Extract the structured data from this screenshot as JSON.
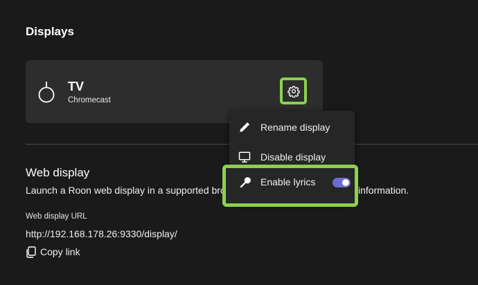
{
  "section": {
    "title": "Displays"
  },
  "device": {
    "name": "TV",
    "type": "Chromecast",
    "icon": "chromecast-device-icon"
  },
  "context_menu": {
    "items": [
      {
        "label": "Rename display",
        "icon": "pencil-icon"
      },
      {
        "label": "Disable display",
        "icon": "monitor-icon"
      },
      {
        "label": "Enable lyrics",
        "icon": "microphone-icon",
        "toggle_on": true
      }
    ]
  },
  "web_display": {
    "title": "Web display",
    "description_start": "Launch a Roon web display in a supported bro",
    "description_end": "information.",
    "url_label": "Web display URL",
    "url": "http://192.168.178.26:9330/display/",
    "copy_label": "Copy link"
  },
  "colors": {
    "background": "#1a1a1a",
    "card": "#2d2d2d",
    "menu": "#262626",
    "highlight": "#8bd14e",
    "toggle_on": "#6b6bd6"
  }
}
